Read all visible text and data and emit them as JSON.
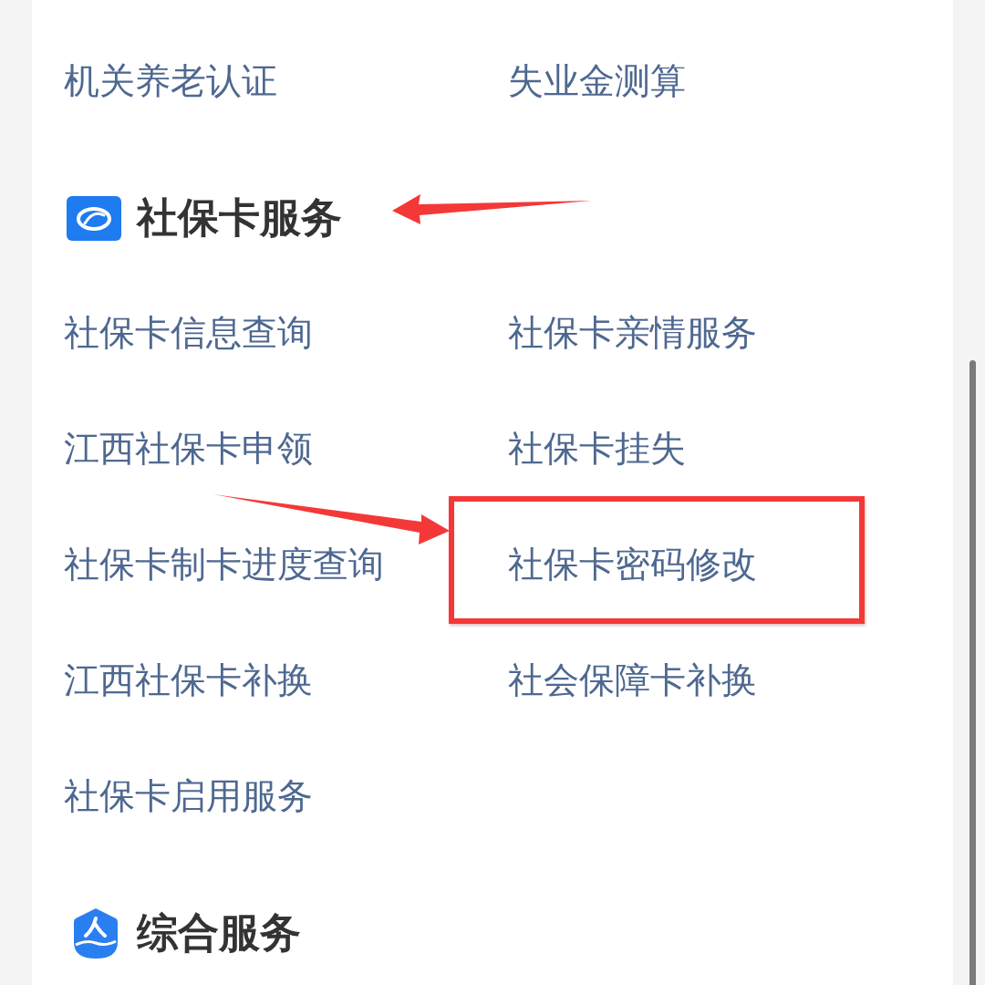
{
  "previous_section": {
    "items": [
      {
        "label": "机关养老认证",
        "highlighted": false
      },
      {
        "label": "失业金测算",
        "highlighted": false
      }
    ]
  },
  "sections": [
    {
      "title": "社保卡服务",
      "arrow": true,
      "items": [
        {
          "label": "社保卡信息查询",
          "highlighted": false
        },
        {
          "label": "社保卡亲情服务",
          "highlighted": false
        },
        {
          "label": "江西社保卡申领",
          "highlighted": false
        },
        {
          "label": "社保卡挂失",
          "highlighted": false
        },
        {
          "label": "社保卡制卡进度查询",
          "highlighted": false
        },
        {
          "label": "社保卡密码修改",
          "highlighted": true
        },
        {
          "label": "江西社保卡补换",
          "highlighted": false
        },
        {
          "label": "社会保障卡补换",
          "highlighted": false
        },
        {
          "label": "社保卡启用服务",
          "highlighted": false
        }
      ]
    },
    {
      "title": "综合服务",
      "arrow": false
    }
  ]
}
